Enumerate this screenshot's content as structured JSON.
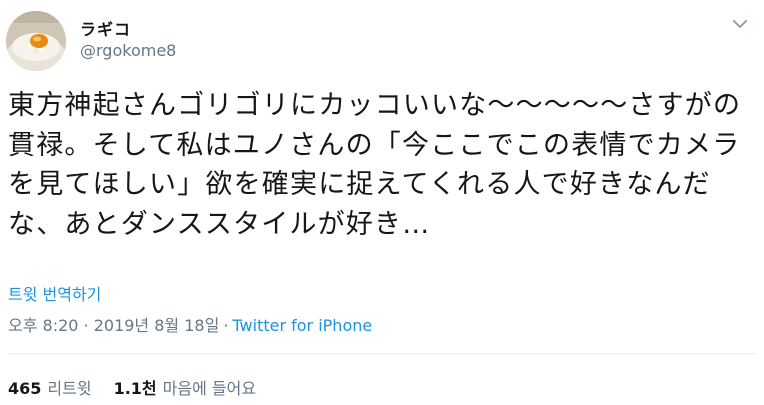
{
  "author": {
    "display_name": "ラギコ",
    "handle": "@rgokome8"
  },
  "tweet": {
    "text": "東方神起さんゴリゴリにカッコいいな〜〜〜〜〜さすがの貫禄。そして私はユノさんの「今ここでこの表情でカメラを見てほしい」欲を確実に捉えてくれる人で好きなんだな、あとダンススタイルが好き…"
  },
  "translate_label": "트윗 번역하기",
  "meta": {
    "timestamp": "오후 8:20 · 2019년 8월 18일",
    "separator": "·",
    "source": "Twitter for iPhone"
  },
  "stats": {
    "retweets_count": "465",
    "retweets_label": "리트윗",
    "likes_count": "1.1천",
    "likes_label": "마음에 들어요"
  },
  "icons": {
    "caret": "chevron-down-icon",
    "avatar": "avatar-image"
  },
  "colors": {
    "link": "#1b95e0",
    "muted": "#657786",
    "text": "#14171a",
    "divider": "#e6ecf0"
  }
}
